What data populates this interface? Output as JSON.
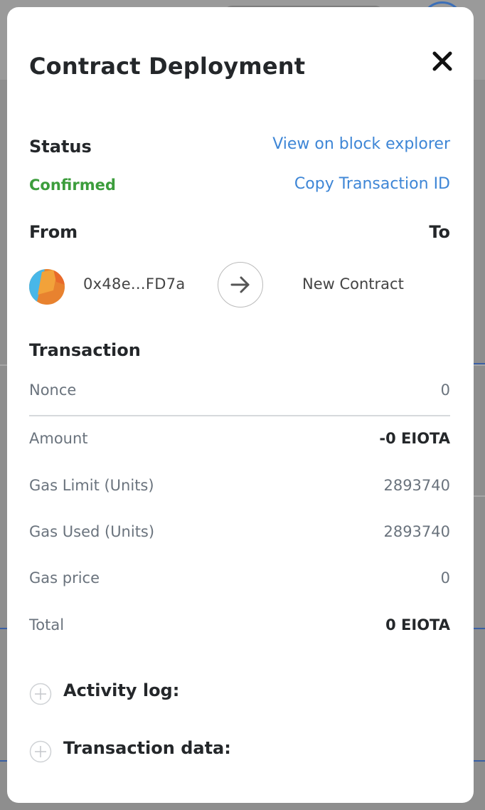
{
  "modal": {
    "title": "Contract Deployment",
    "close_icon": "close-icon"
  },
  "status": {
    "label": "Status",
    "value": "Confirmed",
    "value_color": "#3c9d3c",
    "view_explorer_link": "View on block explorer",
    "copy_tx_link": "Copy Transaction ID"
  },
  "parties": {
    "from_label": "From",
    "to_label": "To",
    "from_address": "0x48e...FD7a",
    "to_address": "New Contract",
    "arrow_icon": "arrow-right-icon"
  },
  "transaction": {
    "heading": "Transaction",
    "rows": [
      {
        "label": "Nonce",
        "value": "0"
      },
      {
        "label": "Amount",
        "value": "-0 EIOTA"
      },
      {
        "label": "Gas Limit (Units)",
        "value": "2893740"
      },
      {
        "label": "Gas Used (Units)",
        "value": "2893740"
      },
      {
        "label": "Gas price",
        "value": "0"
      },
      {
        "label": "Total",
        "value": "0 EIOTA"
      }
    ]
  },
  "sections": {
    "activity_log": "Activity log:",
    "transaction_data": "Transaction data:",
    "expand_icon": "plus-circle-icon"
  },
  "colors": {
    "link": "#3e86d6",
    "heading": "#24272a",
    "muted": "#6a737d"
  }
}
